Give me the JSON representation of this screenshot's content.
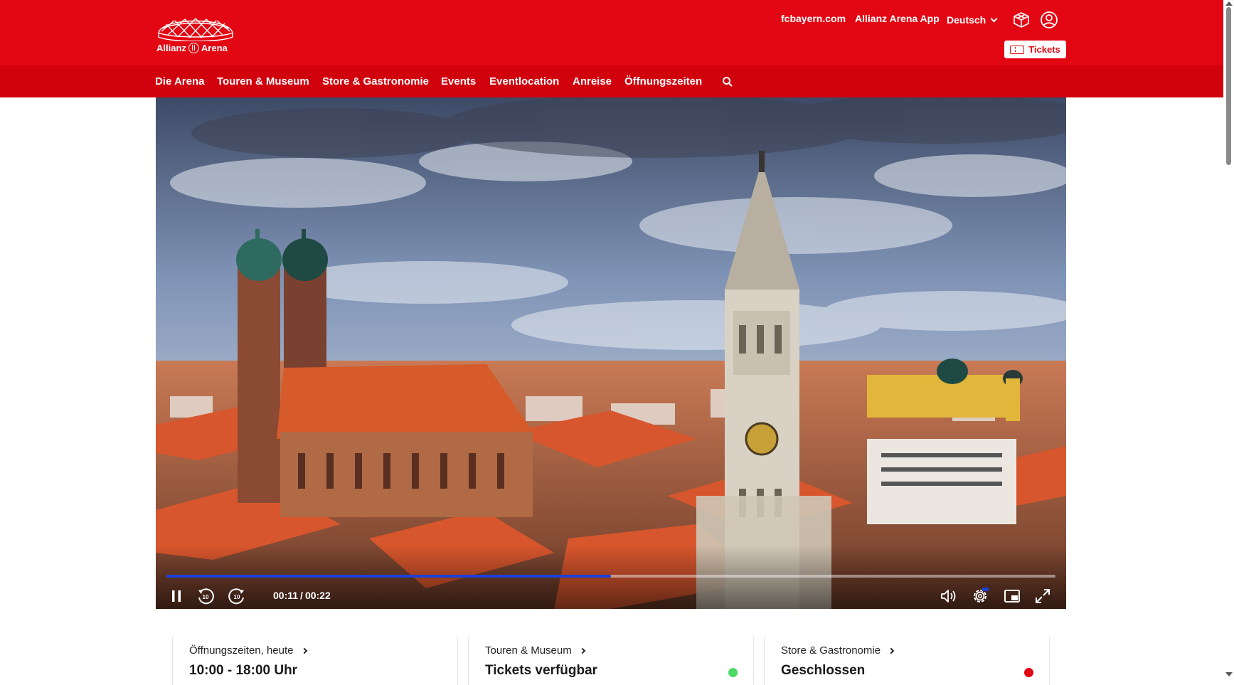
{
  "brand": {
    "logo_text_left": "Allianz",
    "logo_text_right": "Arena",
    "accent": "#e30613",
    "nav_bg": "#d0000d"
  },
  "header": {
    "links": {
      "fcbayern": "fcbayern.com",
      "app": "Allianz Arena App",
      "language": "Deutsch"
    },
    "icons": {
      "cube": "3d-cube-icon",
      "account": "user-account-icon"
    },
    "tickets_label": "Tickets"
  },
  "nav": {
    "items": [
      {
        "label": "Die Arena"
      },
      {
        "label": "Touren & Museum"
      },
      {
        "label": "Store & Gastronomie"
      },
      {
        "label": "Events"
      },
      {
        "label": "Eventlocation"
      },
      {
        "label": "Anreise"
      },
      {
        "label": "Öffnungszeiten"
      }
    ],
    "search_icon": "search-icon"
  },
  "video": {
    "current_time": "00:11",
    "duration": "00:22",
    "progress": 0.5,
    "controls": [
      "pause-icon",
      "rewind-10-icon",
      "forward-10-icon",
      "volume-icon",
      "settings-icon",
      "picture-in-picture-icon",
      "fullscreen-icon"
    ],
    "progress_color": "#1e40d8"
  },
  "cards": [
    {
      "label": "Öffnungszeiten, heute",
      "value": "10:00 - 18:00 Uhr",
      "status": null
    },
    {
      "label": "Touren & Museum",
      "value": "Tickets verfügbar",
      "status": "#4cd964"
    },
    {
      "label": "Store & Gastronomie",
      "value": "Geschlossen",
      "status": "#e30613"
    }
  ]
}
